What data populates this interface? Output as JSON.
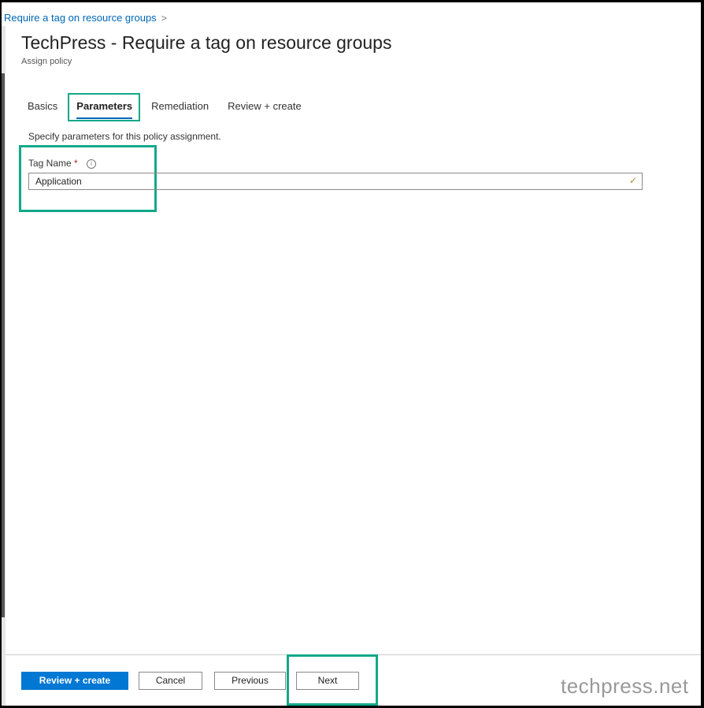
{
  "breadcrumb": {
    "label": "Require a tag on resource groups",
    "separator": ">"
  },
  "header": {
    "title": "TechPress - Require a tag on resource groups",
    "subtitle": "Assign policy"
  },
  "tabs": [
    {
      "label": "Basics",
      "active": false
    },
    {
      "label": "Parameters",
      "active": true
    },
    {
      "label": "Remediation",
      "active": false
    },
    {
      "label": "Review + create",
      "active": false
    }
  ],
  "parameters": {
    "description": "Specify parameters for this policy assignment.",
    "tag_name": {
      "label": "Tag Name",
      "required_marker": "*",
      "info_icon": "i",
      "value": "Application",
      "valid_icon": "✓"
    }
  },
  "footer": {
    "review_create": "Review + create",
    "cancel": "Cancel",
    "previous": "Previous",
    "next": "Next"
  },
  "watermark": "techpress.net",
  "colors": {
    "accent": "#0078d4",
    "highlight": "#12a88a"
  }
}
